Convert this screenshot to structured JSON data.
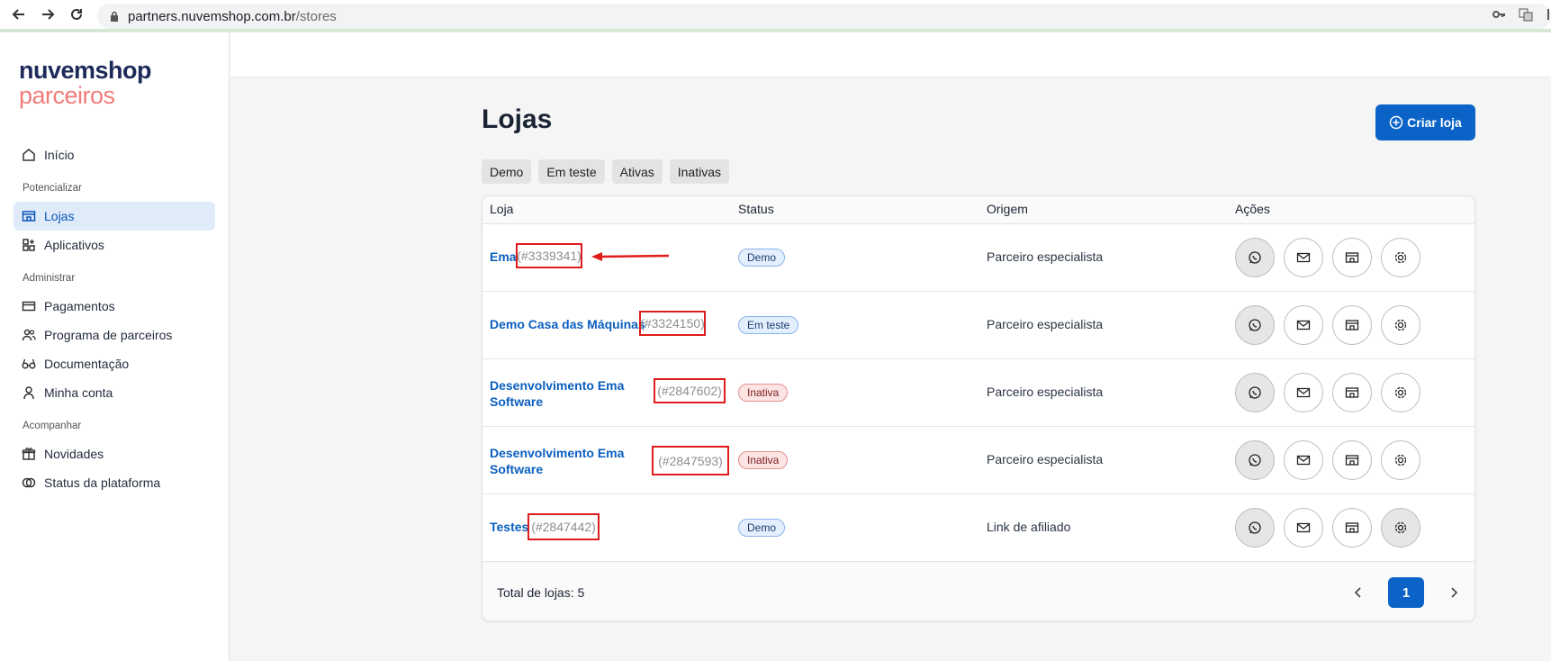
{
  "browser": {
    "url_host": "partners.nuvemshop.com.br",
    "url_path": "/stores"
  },
  "logo": {
    "line1": "nuvemshop",
    "line2": "parceiros"
  },
  "sidebar": {
    "inicio": "Início",
    "section_potencializar": "Potencializar",
    "lojas": "Lojas",
    "aplicativos": "Aplicativos",
    "section_administrar": "Administrar",
    "pagamentos": "Pagamentos",
    "programa": "Programa de parceiros",
    "documentacao": "Documentação",
    "minha_conta": "Minha conta",
    "section_acompanhar": "Acompanhar",
    "novidades": "Novidades",
    "status": "Status da plataforma"
  },
  "page": {
    "title": "Lojas",
    "create_button": "Criar loja",
    "filters": [
      "Demo",
      "Em teste",
      "Ativas",
      "Inativas"
    ]
  },
  "table": {
    "headers": {
      "loja": "Loja",
      "status": "Status",
      "origem": "Origem",
      "acoes": "Ações"
    },
    "rows": [
      {
        "name": "Ema",
        "id": "(#3339341)",
        "status": "Demo",
        "origin": "Parceiro especialista"
      },
      {
        "name": "Demo Casa das Máquinas",
        "id": "(#3324150)",
        "status": "Em teste",
        "origin": "Parceiro especialista"
      },
      {
        "name": "Desenvolvimento Ema Software",
        "id": "(#2847602)",
        "status": "Inativa",
        "origin": "Parceiro especialista"
      },
      {
        "name": "Desenvolvimento Ema Software",
        "id": "(#2847593)",
        "status": "Inativa",
        "origin": "Parceiro especialista"
      },
      {
        "name": "Testes",
        "id": "(#2847442)",
        "status": "Demo",
        "origin": "Link de afiliado"
      }
    ],
    "total": "Total de lojas: 5",
    "current_page": "1"
  },
  "colors": {
    "brand": "#0b63c7",
    "annotation": "#e01b1b"
  },
  "icons": [
    "whatsapp-icon",
    "mail-icon",
    "store-icon",
    "gear-icon"
  ]
}
